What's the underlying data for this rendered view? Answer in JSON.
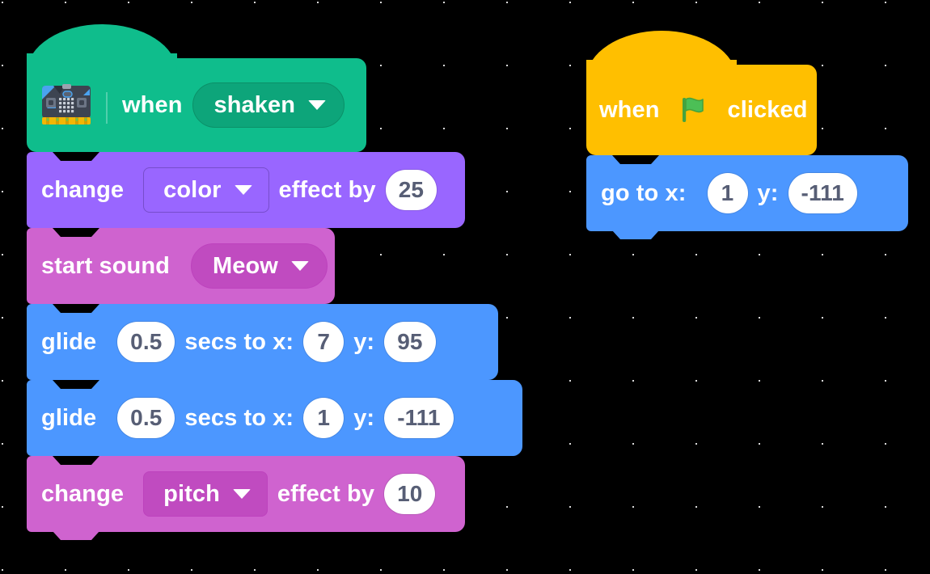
{
  "editor": {
    "name": "scratch-block-workspace",
    "background_color": "#000000",
    "grid_dot_color": "#d9d9d9",
    "grid_spacing_px": 78
  },
  "palette": {
    "events_green": "#0FBD8C",
    "looks_purple": "#9966FF",
    "sound_pink": "#CF63CF",
    "motion_blue": "#4C97FF",
    "events_yellow": "#FFBF00",
    "field_white": "#FFFFFF",
    "field_text": "#575E75"
  },
  "scripts": [
    {
      "id": "script-left",
      "blocks": [
        {
          "id": "when-shaken",
          "shape": "hat",
          "category": "microbit",
          "color": "#0FBD8C",
          "icon": "microbit-icon",
          "label_1": "when",
          "dropdown": {
            "name": "gesture-dropdown",
            "value": "shaken",
            "arrow": "chevron-down-icon"
          }
        },
        {
          "id": "change-color-effect",
          "shape": "stack",
          "category": "looks",
          "color": "#9966FF",
          "label_1": "change",
          "dropdown": {
            "name": "effect-dropdown",
            "value": "color",
            "arrow": "chevron-down-icon"
          },
          "label_2": "effect by",
          "input": {
            "name": "effect-amount-input",
            "value": "25"
          }
        },
        {
          "id": "start-sound",
          "shape": "stack",
          "category": "sound",
          "color": "#CF63CF",
          "label_1": "start sound",
          "dropdown": {
            "name": "sound-dropdown",
            "value": "Meow",
            "arrow": "chevron-down-icon"
          }
        },
        {
          "id": "glide-1",
          "shape": "stack",
          "category": "motion",
          "color": "#4C97FF",
          "label_1": "glide",
          "secs": {
            "name": "glide-secs-input",
            "value": "0.5"
          },
          "label_2": "secs to x:",
          "x": {
            "name": "glide-x-input",
            "value": "7"
          },
          "label_3": "y:",
          "y": {
            "name": "glide-y-input",
            "value": "95"
          }
        },
        {
          "id": "glide-2",
          "shape": "stack",
          "category": "motion",
          "color": "#4C97FF",
          "label_1": "glide",
          "secs": {
            "name": "glide-secs-input",
            "value": "0.5"
          },
          "label_2": "secs to x:",
          "x": {
            "name": "glide-x-input",
            "value": "1"
          },
          "label_3": "y:",
          "y": {
            "name": "glide-y-input",
            "value": "-111"
          }
        },
        {
          "id": "change-pitch-effect",
          "shape": "stack",
          "category": "sound",
          "color": "#CF63CF",
          "label_1": "change",
          "dropdown": {
            "name": "pitch-effect-dropdown",
            "value": "pitch",
            "arrow": "chevron-down-icon"
          },
          "label_2": "effect by",
          "input": {
            "name": "pitch-amount-input",
            "value": "10"
          }
        }
      ]
    },
    {
      "id": "script-right",
      "blocks": [
        {
          "id": "when-flag-clicked",
          "shape": "hat",
          "category": "events",
          "color": "#FFBF00",
          "label_1": "when",
          "icon": "green-flag-icon",
          "label_2": "clicked"
        },
        {
          "id": "go-to-xy",
          "shape": "stack",
          "category": "motion",
          "color": "#4C97FF",
          "label_1": "go to x:",
          "x": {
            "name": "goto-x-input",
            "value": "1"
          },
          "label_2": "y:",
          "y": {
            "name": "goto-y-input",
            "value": "-111"
          }
        }
      ]
    }
  ]
}
